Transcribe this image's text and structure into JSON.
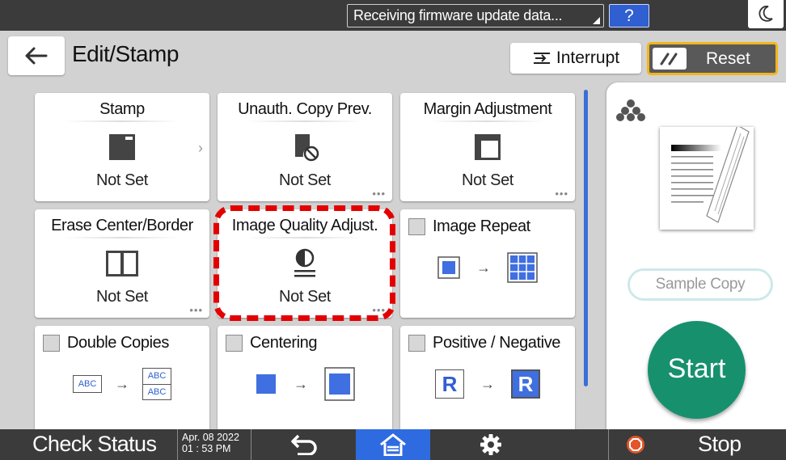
{
  "topbar": {
    "message": "Receiving firmware update data...",
    "help_label": "?",
    "moon_icon": "moon-icon"
  },
  "header": {
    "title": "Edit/Stamp",
    "back_icon": "arrow-left-icon",
    "interrupt_label": "Interrupt",
    "reset_label": "Reset"
  },
  "tiles": {
    "stamp": {
      "title": "Stamp",
      "status": "Not Set"
    },
    "unauth_copy": {
      "title": "Unauth. Copy Prev.",
      "status": "Not Set"
    },
    "margin": {
      "title": "Margin Adjustment",
      "status": "Not Set"
    },
    "erase": {
      "title": "Erase Center/Border",
      "status": "Not Set"
    },
    "image_quality": {
      "title": "Image Quality Adjust.",
      "status": "Not Set",
      "highlighted": true
    },
    "image_repeat": {
      "title": "Image Repeat",
      "checked": false
    },
    "double_copies": {
      "title": "Double Copies",
      "checked": false,
      "abc": "ABC"
    },
    "centering": {
      "title": "Centering",
      "checked": false
    },
    "positive_negative": {
      "title": "Positive / Negative",
      "checked": false,
      "letter": "R"
    }
  },
  "right_panel": {
    "sample_copy_label": "Sample Copy",
    "start_label": "Start"
  },
  "bottombar": {
    "check_status_label": "Check Status",
    "date": "Apr. 08 2022",
    "time": "01 : 53 PM",
    "stop_label": "Stop"
  },
  "colors": {
    "accent_blue": "#2f6be0",
    "start_green": "#17906e",
    "reset_border": "#f2b51c",
    "highlight_red": "#e30000",
    "tile_blue": "#3f6fe0"
  }
}
